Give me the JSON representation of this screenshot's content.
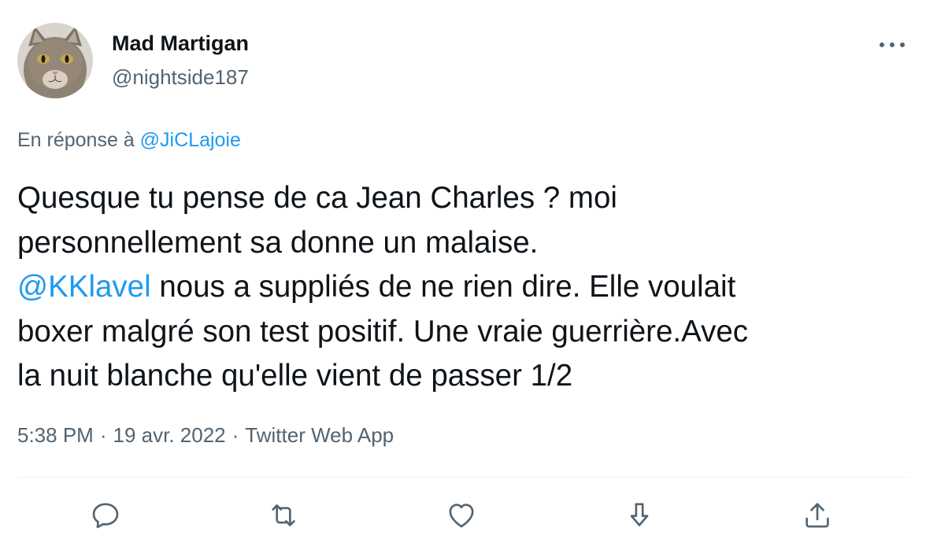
{
  "author": {
    "display_name": "Mad Martigan",
    "handle": "@nightside187",
    "avatar": "cat-avatar"
  },
  "reply_to": {
    "prefix": "En réponse à",
    "mention": "@JiCLajoie"
  },
  "tweet": {
    "line1": "Quesque tu pense de ca Jean Charles ? moi",
    "line2": "personnellement sa donne un malaise.",
    "line3_mention": "@KKlavel",
    "line3_text": " nous a suppliés de ne rien dire. Elle voulait",
    "line4": "boxer malgré son test positif. Une vraie guerrière.Avec",
    "line5": "la nuit blanche qu'elle vient de passer 1/2"
  },
  "meta": {
    "time": "5:38 PM",
    "separator": "·",
    "date": "19 avr. 2022",
    "source": "Twitter Web App"
  },
  "actions": [
    {
      "name": "reply",
      "icon": "speech-bubble-icon"
    },
    {
      "name": "retweet",
      "icon": "retweet-icon"
    },
    {
      "name": "like",
      "icon": "heart-icon"
    },
    {
      "name": "bookmark",
      "icon": "arrow-down-icon"
    },
    {
      "name": "share",
      "icon": "share-upload-icon"
    }
  ],
  "colors": {
    "text": "#0f1419",
    "secondary": "#536471",
    "link": "#1d9bf0",
    "divider": "#eff3f4"
  }
}
